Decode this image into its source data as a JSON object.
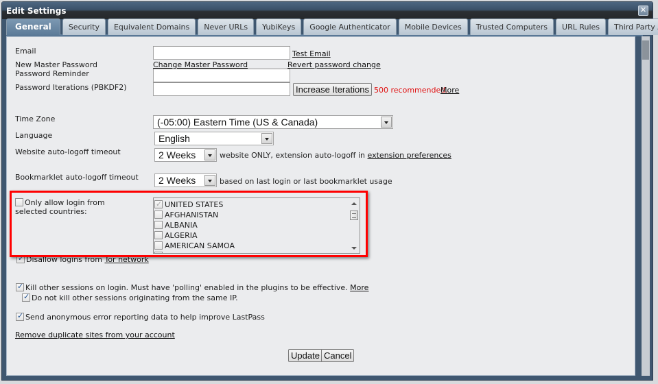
{
  "window": {
    "title": "Edit Settings",
    "close_icon": "close-icon"
  },
  "tabs": [
    {
      "label": "General",
      "active": true
    },
    {
      "label": "Security",
      "active": false
    },
    {
      "label": "Equivalent Domains",
      "active": false
    },
    {
      "label": "Never URLs",
      "active": false
    },
    {
      "label": "YubiKeys",
      "active": false
    },
    {
      "label": "Google Authenticator",
      "active": false
    },
    {
      "label": "Mobile Devices",
      "active": false
    },
    {
      "label": "Trusted Computers",
      "active": false
    },
    {
      "label": "URL Rules",
      "active": false
    },
    {
      "label": "Third Party Access",
      "active": false
    }
  ],
  "general": {
    "email": {
      "label": "Email",
      "value": "",
      "test_link": "Test Email"
    },
    "master_password": {
      "label": "New Master Password",
      "change_link": "Change Master Password",
      "revert_link": "Revert password change"
    },
    "password_reminder": {
      "label": "Password Reminder",
      "value": ""
    },
    "iterations": {
      "label": "Password Iterations (PBKDF2)",
      "value": "",
      "button": "Increase Iterations",
      "recommendation": "500 recommended.",
      "more_link": "More"
    },
    "time_zone": {
      "label": "Time Zone",
      "selected": "(-05:00) Eastern Time (US & Canada)"
    },
    "language": {
      "label": "Language",
      "selected": "English"
    },
    "website_logoff": {
      "label": "Website auto-logoff timeout",
      "selected": "2 Weeks",
      "note": "website ONLY, extension auto-logoff in",
      "note_link": "extension preferences"
    },
    "bookmarklet_logoff": {
      "label": "Bookmarklet auto-logoff timeout",
      "selected": "2 Weeks",
      "note": "based on last login or last bookmarklet usage"
    },
    "country_restriction": {
      "label": "Only allow login from selected countries:",
      "checked": false,
      "countries": [
        {
          "name": "UNITED STATES",
          "checked": true,
          "disabled": true
        },
        {
          "name": "AFGHANISTAN",
          "checked": false
        },
        {
          "name": "ALBANIA",
          "checked": false
        },
        {
          "name": "ALGERIA",
          "checked": false
        },
        {
          "name": "AMERICAN SAMOA",
          "checked": false
        }
      ]
    },
    "tor": {
      "label": "Disallow logins from",
      "link": "Tor network",
      "checked": true
    },
    "kill_sessions": {
      "label": "Kill other sessions on login. Must have 'polling' enabled in the plugins to be effective.",
      "more_link": "More",
      "checked": true
    },
    "same_ip": {
      "label": "Do not kill other sessions originating from the same IP.",
      "checked": true
    },
    "error_reporting": {
      "label": "Send anonymous error reporting data to help improve LastPass",
      "checked": true
    },
    "remove_duplicates_link": "Remove duplicate sites from your account"
  },
  "footer": {
    "update_label": "Update",
    "cancel_label": "Cancel"
  },
  "colors": {
    "highlight_border": "#ff0000",
    "recommendation_text": "#e01010",
    "active_tab": "#5c7b98"
  }
}
